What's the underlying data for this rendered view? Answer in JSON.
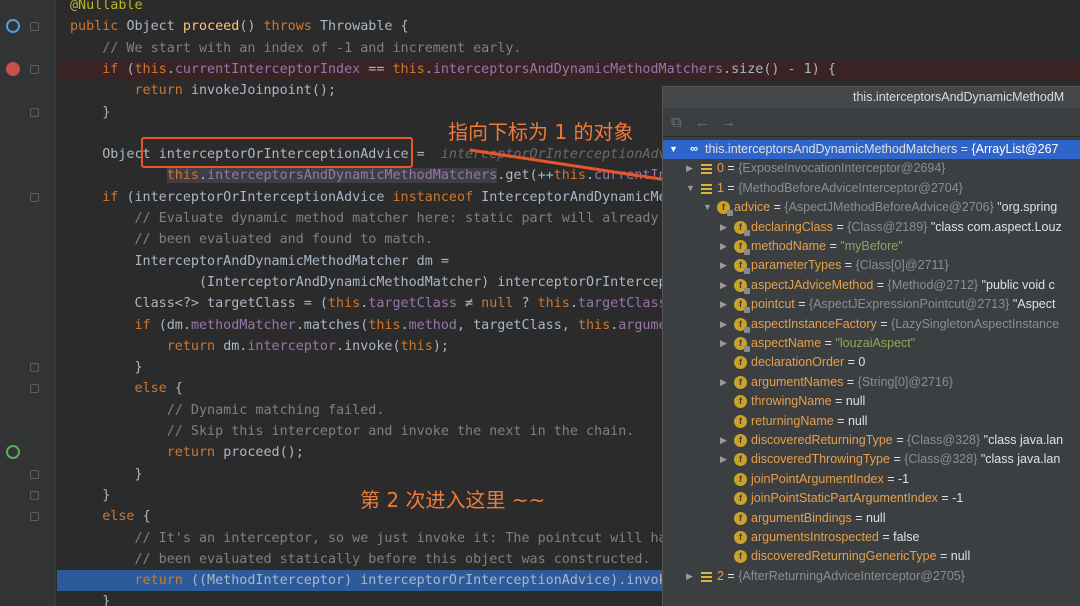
{
  "editor": {
    "lines": [
      {
        "type": "plain",
        "parts": [
          {
            "c": "ann",
            "t": "@Nullable"
          }
        ]
      },
      {
        "type": "plain",
        "parts": [
          {
            "c": "kw",
            "t": "public "
          },
          {
            "c": "",
            "t": "Object "
          },
          {
            "c": "fn",
            "t": "proceed"
          },
          {
            "c": "",
            "t": "() "
          },
          {
            "c": "kw",
            "t": "throws "
          },
          {
            "c": "",
            "t": "Throwable {"
          }
        ]
      },
      {
        "type": "plain",
        "parts": [
          {
            "c": "cm",
            "t": "    // We start with an index of -1 and increment early."
          }
        ]
      },
      {
        "type": "bp",
        "parts": [
          {
            "c": "kw",
            "t": "    if "
          },
          {
            "c": "",
            "t": "("
          },
          {
            "c": "kw",
            "t": "this"
          },
          {
            "c": "",
            "t": "."
          },
          {
            "c": "fld",
            "t": "currentInterceptorIndex"
          },
          {
            "c": "",
            "t": " == "
          },
          {
            "c": "kw",
            "t": "this"
          },
          {
            "c": "",
            "t": "."
          },
          {
            "c": "fld",
            "t": "interceptorsAndDynamicMethodMatchers"
          },
          {
            "c": "",
            "t": ".size() - "
          },
          {
            "c": "",
            "t": "1) {"
          }
        ]
      },
      {
        "type": "plain",
        "parts": [
          {
            "c": "kw",
            "t": "        return "
          },
          {
            "c": "",
            "t": "invokeJoinpoint();"
          }
        ]
      },
      {
        "type": "plain",
        "parts": [
          {
            "c": "",
            "t": "    }"
          }
        ]
      },
      {
        "type": "plain",
        "parts": [
          {
            "c": "",
            "t": ""
          }
        ]
      },
      {
        "type": "plain",
        "parts": [
          {
            "c": "",
            "t": "    Object "
          },
          {
            "c": "",
            "t": "interceptorOrInterceptionAdvice"
          },
          {
            "c": "",
            "t": " =  "
          },
          {
            "c": "hint",
            "t": "interceptorOrInterceptionAdvice"
          }
        ]
      },
      {
        "type": "plain",
        "parts": [
          {
            "c": "",
            "t": "            "
          },
          {
            "c": "kw hl",
            "t": "this"
          },
          {
            "c": "hl",
            "t": "."
          },
          {
            "c": "fld hl",
            "t": "interceptorsAndDynamicMethodMatchers"
          },
          {
            "c": "",
            "t": ".get(++"
          },
          {
            "c": "kw",
            "t": "this"
          },
          {
            "c": "",
            "t": "."
          },
          {
            "c": "fld",
            "t": "currentInter"
          }
        ]
      },
      {
        "type": "plain",
        "parts": [
          {
            "c": "kw",
            "t": "    if "
          },
          {
            "c": "",
            "t": "(interceptorOrInterceptionAdvice "
          },
          {
            "c": "kw",
            "t": "instanceof "
          },
          {
            "c": "",
            "t": "InterceptorAndDynamicMetho"
          }
        ]
      },
      {
        "type": "plain",
        "parts": [
          {
            "c": "cm",
            "t": "        // Evaluate dynamic method matcher here: static part will already hav"
          }
        ]
      },
      {
        "type": "plain",
        "parts": [
          {
            "c": "cm",
            "t": "        // been evaluated and found to match."
          }
        ]
      },
      {
        "type": "plain",
        "parts": [
          {
            "c": "",
            "t": "        InterceptorAndDynamicMethodMatcher dm ="
          }
        ]
      },
      {
        "type": "plain",
        "parts": [
          {
            "c": "",
            "t": "                (InterceptorAndDynamicMethodMatcher) interceptorOrInterceptio"
          }
        ]
      },
      {
        "type": "plain",
        "parts": [
          {
            "c": "",
            "t": "        Class<?> targetClass = ("
          },
          {
            "c": "kw",
            "t": "this"
          },
          {
            "c": "",
            "t": "."
          },
          {
            "c": "fld",
            "t": "targetClass"
          },
          {
            "c": "",
            "t": " ≠ "
          },
          {
            "c": "kw",
            "t": "null "
          },
          {
            "c": "",
            "t": "? "
          },
          {
            "c": "kw",
            "t": "this"
          },
          {
            "c": "",
            "t": "."
          },
          {
            "c": "fld",
            "t": "targetClass"
          },
          {
            "c": "",
            "t": " :"
          }
        ]
      },
      {
        "type": "plain",
        "parts": [
          {
            "c": "kw",
            "t": "        if "
          },
          {
            "c": "",
            "t": "(dm."
          },
          {
            "c": "fld",
            "t": "methodMatcher"
          },
          {
            "c": "",
            "t": ".matches("
          },
          {
            "c": "kw",
            "t": "this"
          },
          {
            "c": "",
            "t": "."
          },
          {
            "c": "fld",
            "t": "method"
          },
          {
            "c": "",
            "t": ", targetClass, "
          },
          {
            "c": "kw",
            "t": "this"
          },
          {
            "c": "",
            "t": "."
          },
          {
            "c": "fld",
            "t": "arguments"
          }
        ]
      },
      {
        "type": "plain",
        "parts": [
          {
            "c": "kw",
            "t": "            return "
          },
          {
            "c": "",
            "t": "dm."
          },
          {
            "c": "fld",
            "t": "interceptor"
          },
          {
            "c": "",
            "t": ".invoke("
          },
          {
            "c": "kw",
            "t": "this"
          },
          {
            "c": "",
            "t": ");"
          }
        ]
      },
      {
        "type": "plain",
        "parts": [
          {
            "c": "",
            "t": "        }"
          }
        ]
      },
      {
        "type": "plain",
        "parts": [
          {
            "c": "kw",
            "t": "        else "
          },
          {
            "c": "",
            "t": "{"
          }
        ]
      },
      {
        "type": "plain",
        "parts": [
          {
            "c": "cm",
            "t": "            // Dynamic matching failed."
          }
        ]
      },
      {
        "type": "plain",
        "parts": [
          {
            "c": "cm",
            "t": "            // Skip this interceptor and invoke the next in the chain."
          }
        ]
      },
      {
        "type": "plain",
        "parts": [
          {
            "c": "kw",
            "t": "            return "
          },
          {
            "c": "",
            "t": "proceed();"
          }
        ]
      },
      {
        "type": "plain",
        "parts": [
          {
            "c": "",
            "t": "        }"
          }
        ]
      },
      {
        "type": "plain",
        "parts": [
          {
            "c": "",
            "t": "    }"
          }
        ]
      },
      {
        "type": "plain",
        "parts": [
          {
            "c": "kw",
            "t": "    else "
          },
          {
            "c": "",
            "t": "{"
          }
        ]
      },
      {
        "type": "plain",
        "parts": [
          {
            "c": "cm",
            "t": "        // It's an interceptor, so we just invoke it: The pointcut will have"
          }
        ]
      },
      {
        "type": "plain",
        "parts": [
          {
            "c": "cm",
            "t": "        // been evaluated statically before this object was constructed."
          }
        ]
      },
      {
        "type": "exec",
        "parts": [
          {
            "c": "kw",
            "t": "        return "
          },
          {
            "c": "",
            "t": "((MethodInterceptor) interceptorOrInterceptionAdvice).invoke("
          }
        ]
      },
      {
        "type": "plain",
        "parts": [
          {
            "c": "",
            "t": "    }"
          }
        ]
      }
    ]
  },
  "annotations": {
    "arrow_text": "指向下标为 1 的对象",
    "second_text": "第 2 次进入这里 ~~"
  },
  "popup": {
    "title": "this.interceptorsAndDynamicMethodM",
    "rows": [
      {
        "indent": 0,
        "toggle": "▼",
        "icon": "oo",
        "sel": true,
        "name": "this.interceptorsAndDynamicMethodMatchers",
        "eq": " = ",
        "gray": "{ArrayList@267",
        "val": ""
      },
      {
        "indent": 1,
        "toggle": "▶",
        "icon": "lines",
        "sel": false,
        "name": "0",
        "eq": " = ",
        "gray": "{ExposeInvocationInterceptor@2694}",
        "val": ""
      },
      {
        "indent": 1,
        "toggle": "▼",
        "icon": "lines",
        "sel": false,
        "name": "1",
        "eq": " = ",
        "gray": "{MethodBeforeAdviceInterceptor@2704}",
        "val": ""
      },
      {
        "indent": 2,
        "toggle": "▼",
        "icon": "lock",
        "sel": false,
        "name": "advice",
        "eq": " = ",
        "gray": "{AspectJMethodBeforeAdvice@2706}",
        "val": " \"org.spring"
      },
      {
        "indent": 3,
        "toggle": "▶",
        "icon": "lock",
        "sel": false,
        "name": "declaringClass",
        "eq": " = ",
        "gray": "{Class@2189}",
        "val": " \"class com.aspect.Louz"
      },
      {
        "indent": 3,
        "toggle": "▶",
        "icon": "lock",
        "sel": false,
        "name": "methodName",
        "eq": " = ",
        "gray": "",
        "val": "\"myBefore\"",
        "str": true
      },
      {
        "indent": 3,
        "toggle": "▶",
        "icon": "lock",
        "sel": false,
        "name": "parameterTypes",
        "eq": " = ",
        "gray": "{Class[0]@2711}",
        "val": ""
      },
      {
        "indent": 3,
        "toggle": "▶",
        "icon": "lock",
        "sel": false,
        "name": "aspectJAdviceMethod",
        "eq": " = ",
        "gray": "{Method@2712}",
        "val": " \"public void c"
      },
      {
        "indent": 3,
        "toggle": "▶",
        "icon": "lock",
        "sel": false,
        "name": "pointcut",
        "eq": " = ",
        "gray": "{AspectJExpressionPointcut@2713}",
        "val": " \"Aspect"
      },
      {
        "indent": 3,
        "toggle": "▶",
        "icon": "lock",
        "sel": false,
        "name": "aspectInstanceFactory",
        "eq": " = ",
        "gray": "{LazySingletonAspectInstance",
        "val": ""
      },
      {
        "indent": 3,
        "toggle": "▶",
        "icon": "lock",
        "sel": false,
        "name": "aspectName",
        "eq": " = ",
        "gray": "",
        "val": "\"louzaiAspect\"",
        "str": true
      },
      {
        "indent": 3,
        "toggle": "",
        "icon": "f",
        "sel": false,
        "name": "declarationOrder",
        "eq": " = ",
        "gray": "",
        "val": "0"
      },
      {
        "indent": 3,
        "toggle": "▶",
        "icon": "f",
        "sel": false,
        "name": "argumentNames",
        "eq": " = ",
        "gray": "{String[0]@2716}",
        "val": ""
      },
      {
        "indent": 3,
        "toggle": "",
        "icon": "f",
        "sel": false,
        "name": "throwingName",
        "eq": " = ",
        "gray": "",
        "val": "null"
      },
      {
        "indent": 3,
        "toggle": "",
        "icon": "f",
        "sel": false,
        "name": "returningName",
        "eq": " = ",
        "gray": "",
        "val": "null"
      },
      {
        "indent": 3,
        "toggle": "▶",
        "icon": "f",
        "sel": false,
        "name": "discoveredReturningType",
        "eq": " = ",
        "gray": "{Class@328}",
        "val": " \"class java.lan"
      },
      {
        "indent": 3,
        "toggle": "▶",
        "icon": "f",
        "sel": false,
        "name": "discoveredThrowingType",
        "eq": " = ",
        "gray": "{Class@328}",
        "val": " \"class java.lan"
      },
      {
        "indent": 3,
        "toggle": "",
        "icon": "f",
        "sel": false,
        "name": "joinPointArgumentIndex",
        "eq": " = ",
        "gray": "",
        "val": "-1"
      },
      {
        "indent": 3,
        "toggle": "",
        "icon": "f",
        "sel": false,
        "name": "joinPointStaticPartArgumentIndex",
        "eq": " = ",
        "gray": "",
        "val": "-1"
      },
      {
        "indent": 3,
        "toggle": "",
        "icon": "f",
        "sel": false,
        "name": "argumentBindings",
        "eq": " = ",
        "gray": "",
        "val": "null"
      },
      {
        "indent": 3,
        "toggle": "",
        "icon": "f",
        "sel": false,
        "name": "argumentsIntrospected",
        "eq": " = ",
        "gray": "",
        "val": "false"
      },
      {
        "indent": 3,
        "toggle": "",
        "icon": "f",
        "sel": false,
        "name": "discoveredReturningGenericType",
        "eq": " = ",
        "gray": "",
        "val": "null"
      },
      {
        "indent": 1,
        "toggle": "▶",
        "icon": "lines",
        "sel": false,
        "name": "2",
        "eq": " = ",
        "gray": "{AfterReturningAdviceInterceptor@2705}",
        "val": ""
      }
    ]
  }
}
